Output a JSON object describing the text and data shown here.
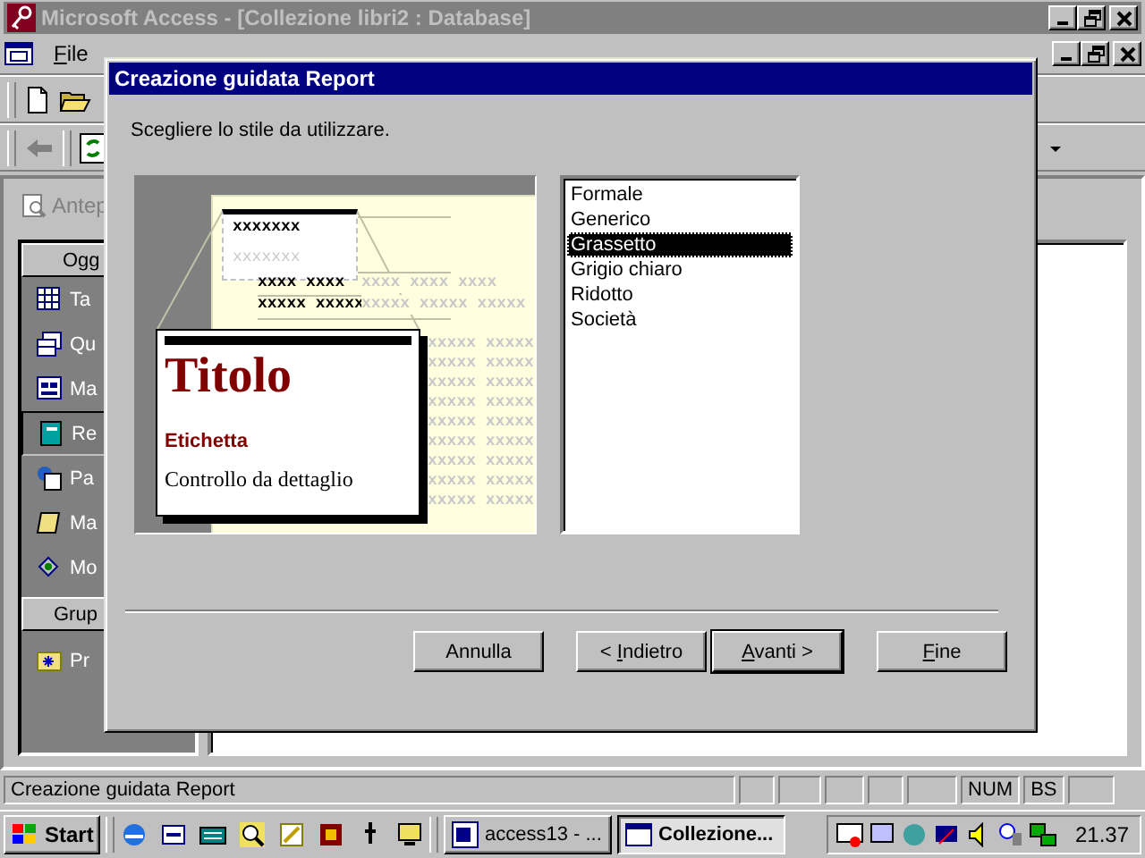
{
  "app": {
    "title": "Microsoft Access - [Collezione libri2 : Database]",
    "active": false
  },
  "menu_bar": {
    "items": [
      {
        "key": "F",
        "post": "ile"
      }
    ]
  },
  "database_window": {
    "preview_button": "Antep",
    "objects_header": "Ogg",
    "objects": [
      {
        "label": "Ta",
        "selected": false
      },
      {
        "label": "Qu",
        "selected": false
      },
      {
        "label": "Ma",
        "selected": false
      },
      {
        "label": "Re",
        "selected": true
      },
      {
        "label": "Pa",
        "selected": false
      },
      {
        "label": "Ma",
        "selected": false
      },
      {
        "label": "Mo",
        "selected": false
      }
    ],
    "groups_header": "Grup",
    "groups": [
      {
        "label": "Pr"
      }
    ]
  },
  "dialog": {
    "title": "Creazione guidata Report",
    "prompt": "Scegliere lo stile da utilizzare.",
    "preview": {
      "header_sample": "xxxxxxx",
      "header_sample_faint": "xxxxxxx",
      "rows": [
        {
          "bold": "xxxx xxxx",
          "faint": "xxxx xxxx xxxx"
        },
        {
          "bold": "xxxxx xxxxx",
          "faint": "xxxxx xxxxx xxxxx"
        }
      ],
      "detail_rows": [
        "xxxxx xxxxx",
        "xxxxx xxxxx",
        "xxxxx xxxxx",
        "xxxxx xxxxx",
        "xxxxx xxxxx",
        "xxxxx xxxxx",
        "xxxxx xxxxx",
        "xxxxx xxxxx",
        "xxxxx xxxxx"
      ],
      "sample_title": "Titolo",
      "sample_label": "Etichetta",
      "sample_control": "Controllo da dettaglio"
    },
    "styles": [
      {
        "label": "Formale",
        "selected": false
      },
      {
        "label": "Generico",
        "selected": false
      },
      {
        "label": "Grassetto",
        "selected": true
      },
      {
        "label": "Grigio chiaro",
        "selected": false
      },
      {
        "label": "Ridotto",
        "selected": false
      },
      {
        "label": "Società",
        "selected": false
      }
    ],
    "buttons": [
      {
        "pre": "Annulla",
        "default": false
      },
      {
        "pre": "< ",
        "key": "I",
        "post": "ndietro",
        "default": false
      },
      {
        "key": "A",
        "post": "vanti >",
        "default": true
      },
      {
        "key": "F",
        "post": "ine",
        "default": false
      }
    ]
  },
  "status_bar": {
    "text": "Creazione guidata Report",
    "indicators": [
      "NUM",
      "BS"
    ]
  },
  "taskbar": {
    "start": "Start",
    "tasks": [
      {
        "label": "access13 - ...",
        "selected": false
      },
      {
        "label": "Collezione...",
        "selected": true
      }
    ],
    "clock": "21.37"
  }
}
